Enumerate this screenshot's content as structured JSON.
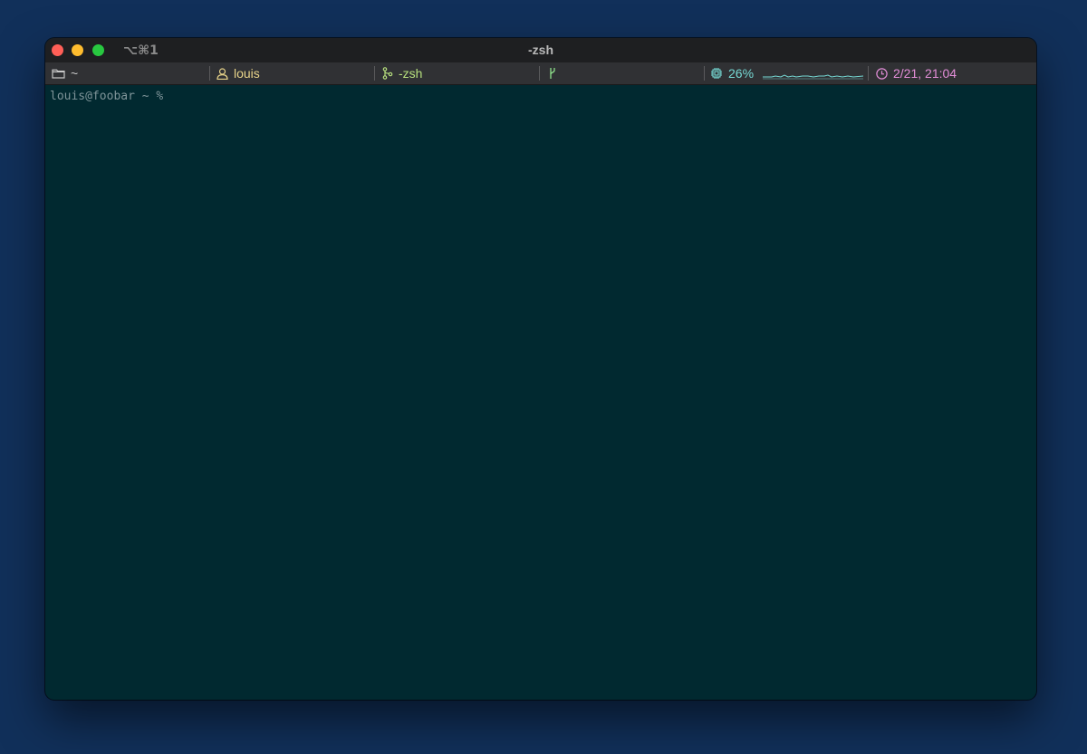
{
  "window": {
    "title": "-zsh",
    "shortcut": "⌥⌘1"
  },
  "statusbar": {
    "directory": {
      "icon": "folder-icon",
      "value": "~"
    },
    "user": {
      "icon": "user-icon",
      "value": "louis"
    },
    "job": {
      "icon": "git-branch-icon",
      "value": "-zsh"
    },
    "branch": {
      "icon": "branch-fork-icon",
      "value": ""
    },
    "cpu": {
      "icon": "cpu-chip-icon",
      "value": "26%"
    },
    "clock": {
      "icon": "clock-icon",
      "value": "2/21, 21:04"
    }
  },
  "terminal": {
    "prompt": "louis@foobar ~ %"
  },
  "colors": {
    "background": "#11305a",
    "terminal_bg": "#012930",
    "titlebar_bg": "#1e1f21",
    "statusbar_bg": "#303134"
  }
}
